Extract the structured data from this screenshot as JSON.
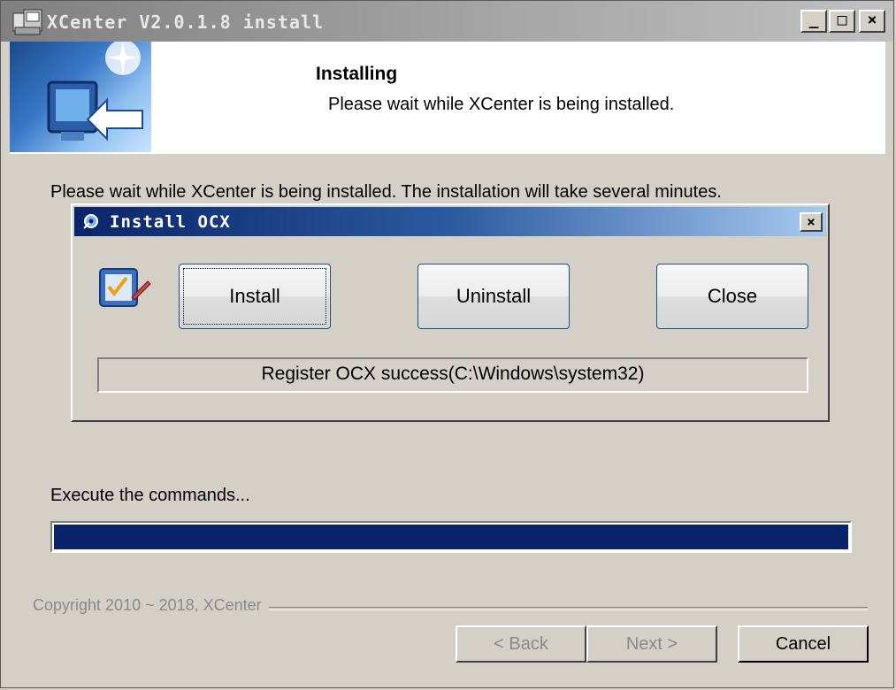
{
  "window": {
    "title": "XCenter V2.0.1.8 install",
    "min_label": "_",
    "max_label": "□",
    "close_label": "×"
  },
  "banner": {
    "title": "Installing",
    "subtitle": "Please wait while XCenter is being installed."
  },
  "main": {
    "wait_text": "Please wait while XCenter is being installed. The installation will take several minutes.",
    "exec_text": "Execute the commands...",
    "progress": 1.0
  },
  "dialog": {
    "title": "Install OCX",
    "close_label": "×",
    "install_label": "Install",
    "uninstall_label": "Uninstall",
    "close_button_label": "Close",
    "status": "Register OCX success(C:\\Windows\\system32)"
  },
  "footer": {
    "copyright": "Copyright 2010 ~ 2018, XCenter",
    "back_label": "< Back",
    "next_label": "Next >",
    "cancel_label": "Cancel"
  },
  "colors": {
    "progress_fill": "#0a246a",
    "dialog_titlebar": "#0a246a"
  }
}
